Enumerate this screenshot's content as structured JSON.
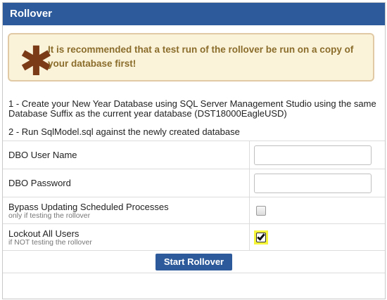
{
  "header": {
    "title": "Rollover"
  },
  "warning": {
    "icon": "asterisk-icon",
    "text": "It is recommended that a test run of the rollover be run on a copy of your database first!"
  },
  "steps": [
    "1 - Create your New Year Database using SQL Server Management Studio using the same Database Suffix as the current year database (DST18000EagleUSD)",
    "2 - Run SqlModel.sql against the newly created database"
  ],
  "form": {
    "dbo_user_label": "DBO User Name",
    "dbo_user_value": "",
    "dbo_password_label": "DBO Password",
    "dbo_password_value": "",
    "bypass_label": "Bypass Updating Scheduled Processes",
    "bypass_hint": "only if testing the rollover",
    "bypass_checked": false,
    "lockout_label": "Lockout All Users",
    "lockout_hint": "if NOT testing the rollover",
    "lockout_checked": true
  },
  "actions": {
    "start_label": "Start Rollover"
  },
  "colors": {
    "header": "#2c5a9a",
    "warning_bg": "#fbf2da",
    "warning_text": "#8a6d2b",
    "highlight": "#f7f53a"
  }
}
